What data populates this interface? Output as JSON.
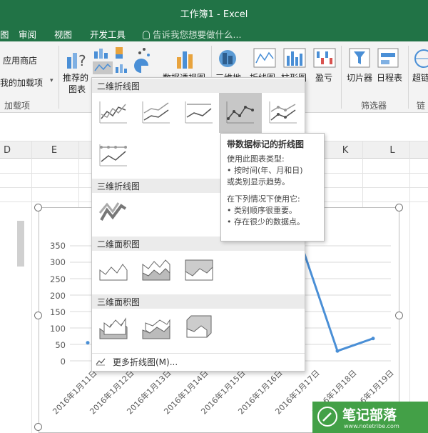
{
  "window": {
    "title": "工作簿1 - Excel"
  },
  "ribbon": {
    "tabs": [
      "图",
      "审阅",
      "视图",
      "开发工具"
    ],
    "tell_me": "告诉我您想要做什么...",
    "addins": {
      "store": "应用商店",
      "my_addins": "我的加载项",
      "group": "加载项"
    },
    "charts": {
      "recommended_line1": "推荐的",
      "recommended_line2": "图表",
      "pivot_chart": "数据透视图",
      "map_3d": "三维地"
    },
    "sparklines": {
      "line": "折线图",
      "column": "柱形图",
      "winloss": "盈亏"
    },
    "filters": {
      "slicer": "切片器",
      "timeline": "日程表",
      "group": "筛选器"
    },
    "links": {
      "link": "超链",
      "group": "链"
    }
  },
  "grid": {
    "columns": [
      "D",
      "E",
      "K",
      "L"
    ]
  },
  "gallery": {
    "sections": [
      "二维折线图",
      "三维折线图",
      "二维面积图",
      "三维面积图"
    ],
    "more_label": "更多折线图(M)..."
  },
  "tooltip": {
    "title": "带数据标记的折线图",
    "lines": [
      "使用此图表类型:",
      "• 按时间(年、月和日)",
      "或类别显示趋势。",
      "",
      "在下列情况下使用它:",
      "• 类别顺序很重要。",
      "• 存在很少的数据点。"
    ]
  },
  "chart_data": {
    "type": "line",
    "categories": [
      "2016年1月11日",
      "2016年1月12日",
      "2016年1月13日",
      "2016年1月14日",
      "2016年1月15日",
      "2016年1月16日",
      "2016年1月17日",
      "2016年1月18日",
      "2016年1月19日"
    ],
    "values": [
      55,
      null,
      null,
      null,
      null,
      null,
      350,
      30,
      68
    ],
    "yticks": [
      "350",
      "300",
      "250",
      "200",
      "150",
      "100",
      "50",
      "0"
    ],
    "ylim": [
      0,
      350
    ],
    "line_color": "#4a8fd6",
    "grid": true
  },
  "watermark": {
    "name": "笔记部落",
    "url": "www.notetribe.com"
  },
  "colors": {
    "excel_green": "#217346",
    "watermark_green": "#43a047",
    "selected_thumb": "#c7c7c7"
  }
}
